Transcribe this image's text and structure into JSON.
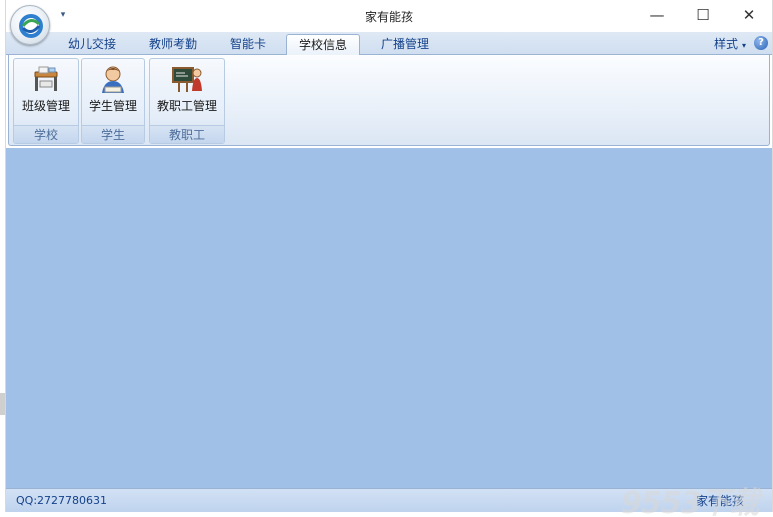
{
  "window": {
    "title": "家有能孩",
    "quick_access_caret": "▾",
    "minimize_glyph": "—",
    "maximize_glyph": "☐",
    "close_glyph": "✕"
  },
  "tabs": [
    {
      "label": "幼儿交接",
      "active": false
    },
    {
      "label": "教师考勤",
      "active": false
    },
    {
      "label": "智能卡",
      "active": false
    },
    {
      "label": "学校信息",
      "active": true
    },
    {
      "label": "广播管理",
      "active": false
    }
  ],
  "style_menu": {
    "label": "样式",
    "caret": "▾"
  },
  "help": {
    "glyph": "?"
  },
  "ribbon_groups": [
    {
      "caption": "学校",
      "button_label": "班级管理",
      "icon": "school-desk-icon"
    },
    {
      "caption": "学生",
      "button_label": "学生管理",
      "icon": "student-icon"
    },
    {
      "caption": "教职工",
      "button_label": "教职工管理",
      "icon": "teacher-blackboard-icon"
    }
  ],
  "statusbar": {
    "qq": "QQ:2727780631",
    "brand": "家有能孩"
  },
  "watermark": {
    "text": "9553下载"
  },
  "colors": {
    "workspace": "#a1c0e8",
    "tab_text": "#15428b",
    "ribbon_border": "#9ab3d3"
  }
}
